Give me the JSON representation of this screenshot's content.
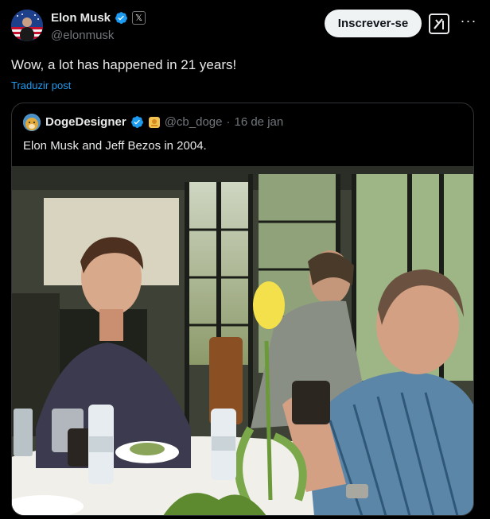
{
  "author": {
    "name": "Elon Musk",
    "handle": "@elonmusk",
    "avatar_icon": "avatar-flag-icon",
    "verified_icon": "verified-badge-icon",
    "affiliate_icon": "x-logo-icon"
  },
  "actions": {
    "subscribe_label": "Inscrever-se",
    "grok_icon": "grok-icon",
    "more_icon": "more-icon",
    "more_glyph": "···"
  },
  "post": {
    "text": "Wow, a lot has happened in 21 years!",
    "translate_label": "Traduzir post"
  },
  "quote": {
    "name": "DogeDesigner",
    "handle": "@cb_doge",
    "separator": "·",
    "date": "16 de jan",
    "text": "Elon Musk and Jeff Bezos in 2004.",
    "image_icon": "restaurant-photo"
  },
  "colors": {
    "accent": "#1d9bf0",
    "background": "#000000",
    "text": "#e7e9ea",
    "muted": "#71767b",
    "border": "#2f3336"
  }
}
